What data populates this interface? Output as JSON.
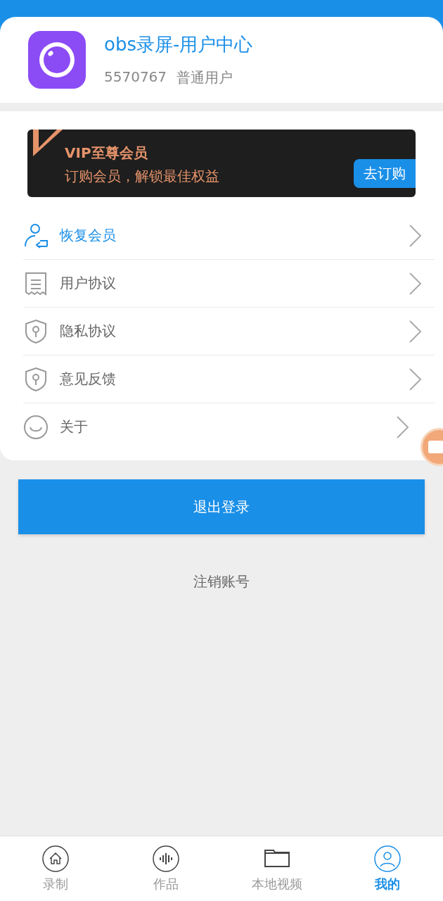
{
  "profile": {
    "title": "obs录屏-用户中心",
    "user_id": "5570767",
    "user_type": "普通用户"
  },
  "vip_banner": {
    "title": "VIP至尊会员",
    "subtitle": "订购会员，解锁最佳权益",
    "button": "去订购"
  },
  "menu": [
    {
      "label": "恢复会员",
      "kind": "restore",
      "highlighted": true
    },
    {
      "label": "用户协议",
      "kind": "document",
      "highlighted": false
    },
    {
      "label": "隐私协议",
      "kind": "shield",
      "highlighted": false
    },
    {
      "label": "意见反馈",
      "kind": "shield",
      "highlighted": false
    },
    {
      "label": "关于",
      "kind": "smile",
      "highlighted": false
    }
  ],
  "logout_button": "退出登录",
  "cancel_account": "注销账号",
  "tabs": [
    {
      "label": "录制",
      "kind": "home",
      "selected": false
    },
    {
      "label": "作品",
      "kind": "audio",
      "selected": false
    },
    {
      "label": "本地视频",
      "kind": "folder",
      "selected": false
    },
    {
      "label": "我的",
      "kind": "user",
      "selected": true
    }
  ]
}
